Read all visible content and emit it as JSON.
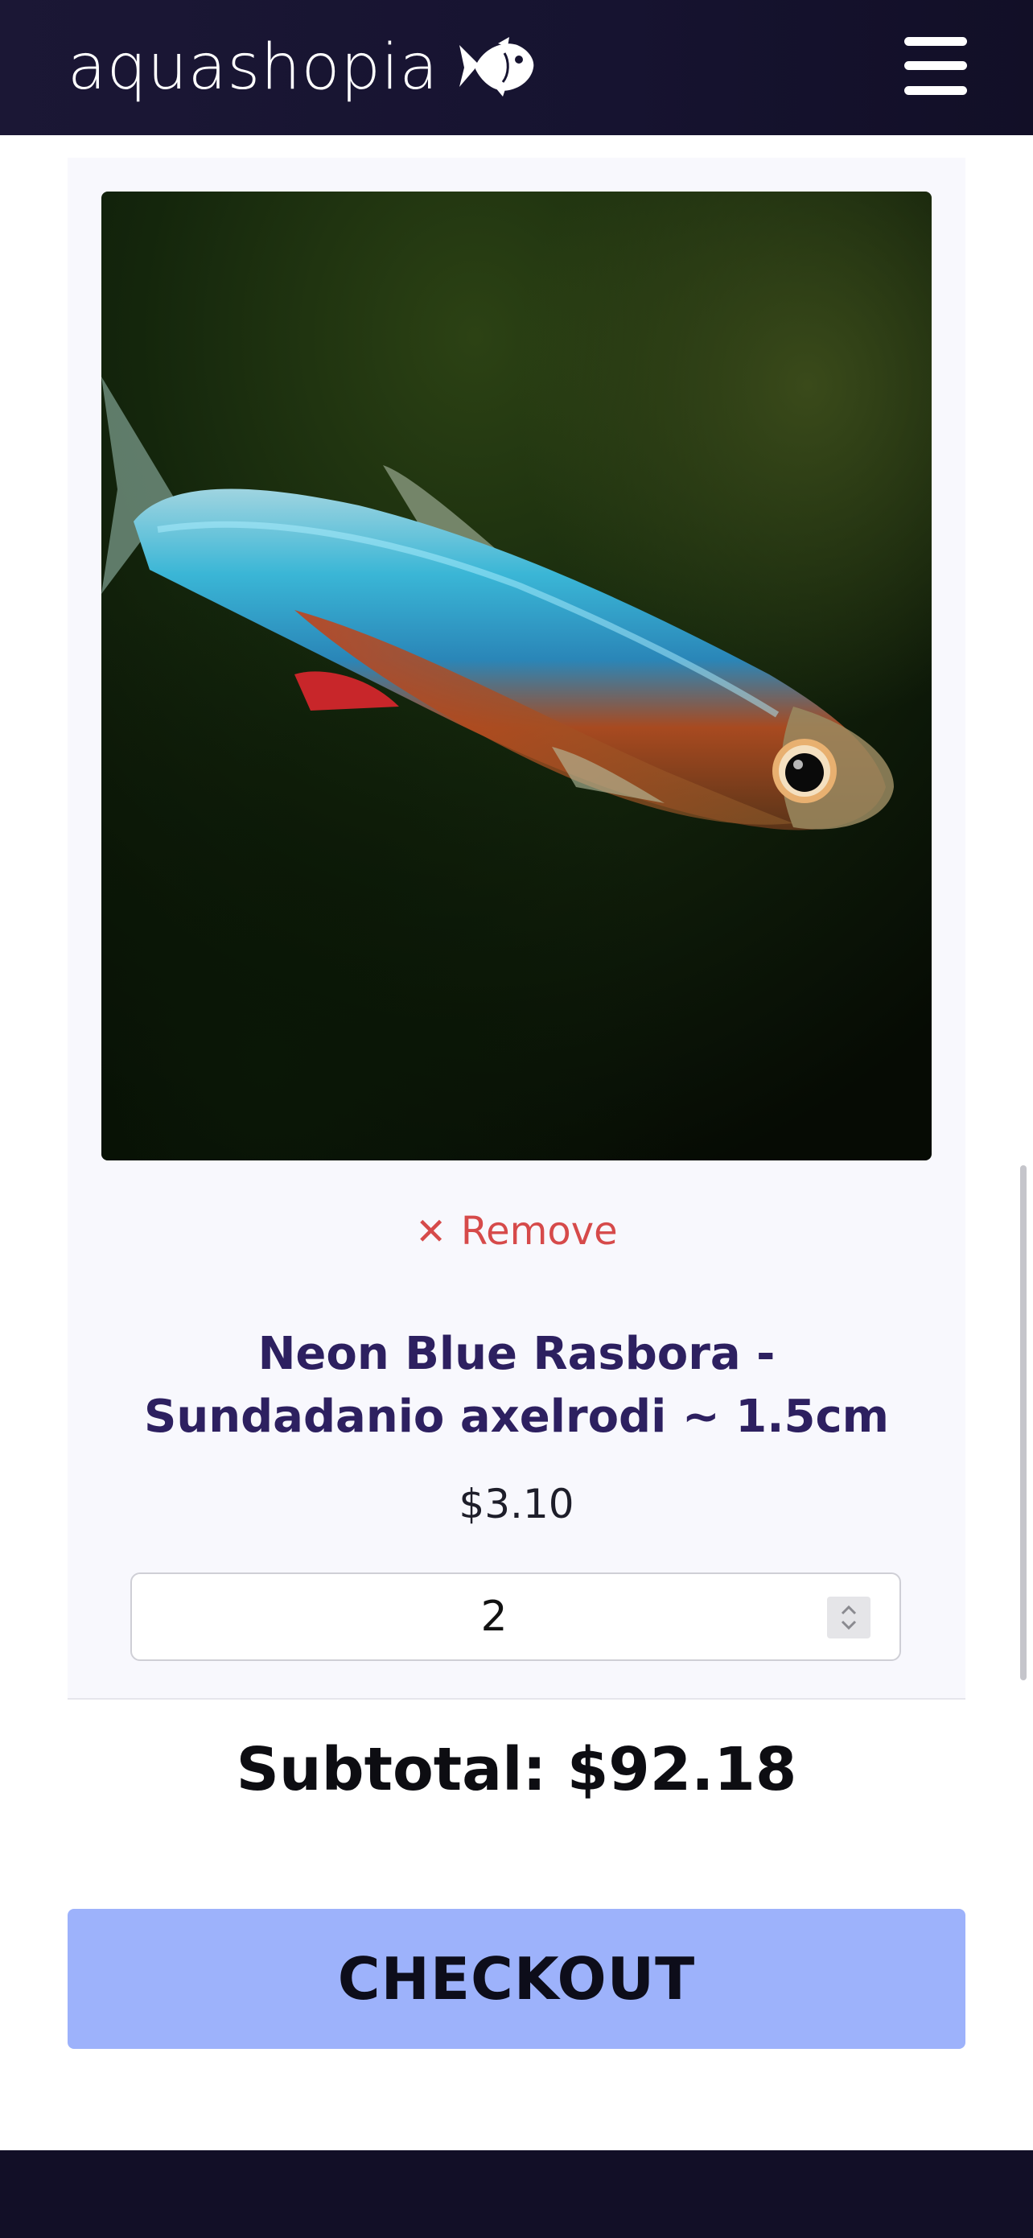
{
  "header": {
    "logo_text": "aquashopia",
    "logo_icon": "fish-icon",
    "menu_icon": "hamburger-menu-icon"
  },
  "cart_item": {
    "image_alt": "Neon Blue Rasbora fish",
    "remove_symbol": "✕",
    "remove_label": "Remove",
    "name": "Neon Blue Rasbora - Sundadanio axelrodi ~ 1.5cm",
    "price": "$3.10",
    "quantity": "2"
  },
  "summary": {
    "subtotal": "Subtotal: $92.18",
    "checkout_label": "CHECKOUT"
  },
  "colors": {
    "header_bg": "#161330",
    "product_name": "#2d2060",
    "remove": "#d64a4a",
    "checkout_bg": "#9db2fb"
  }
}
